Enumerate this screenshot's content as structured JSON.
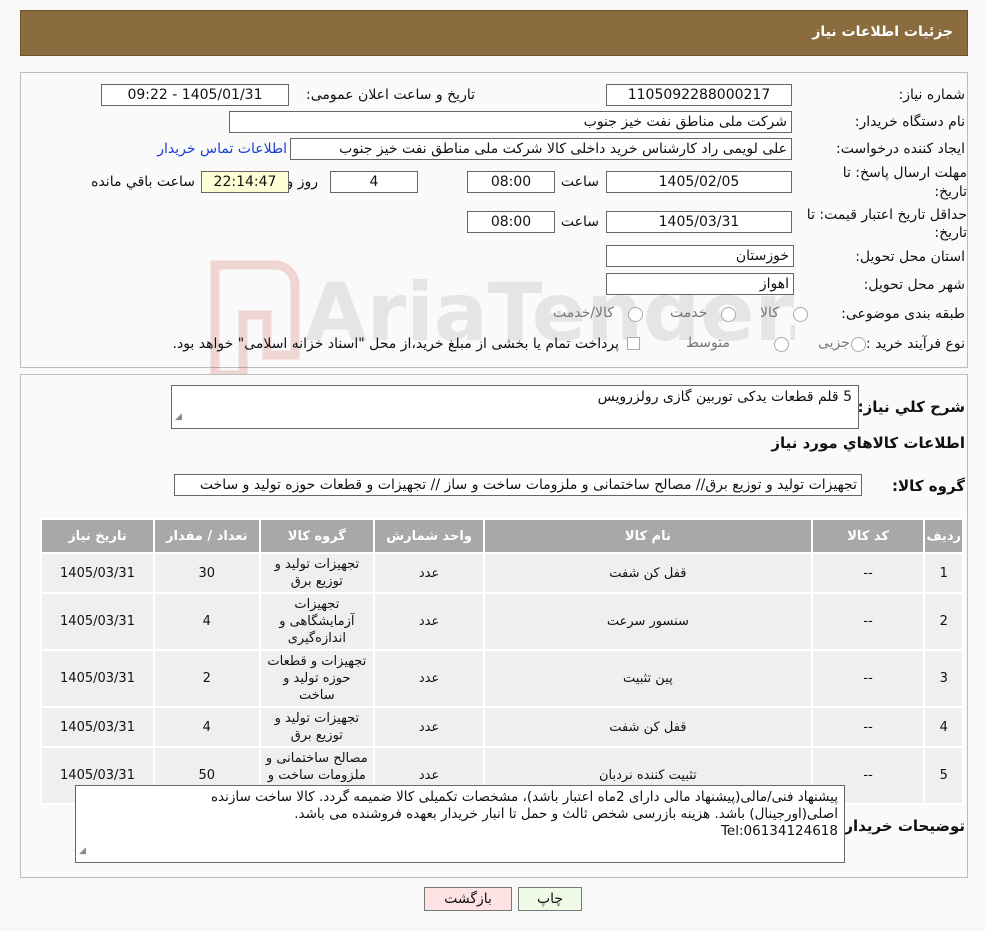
{
  "header": {
    "title": "جزئیات اطلاعات نیاز"
  },
  "form": {
    "need_number_label": "شماره نیاز:",
    "need_number": "1105092288000217",
    "announce_label": "تاریخ و ساعت اعلان عمومی:",
    "announce_value": "1405/01/31 - 09:22",
    "buyer_org_label": "نام دستگاه خریدار:",
    "buyer_org": "شرکت ملی مناطق نفت خیز جنوب",
    "creator_label": "ایجاد کننده درخواست:",
    "creator": "علی  لویمی راد  کارشناس خرید داخلی کالا شرکت ملی مناطق نفت خیز جنوب",
    "contact_link": "اطلاعات تماس خریدار",
    "reply_deadline_label_1": "مهلت ارسال پاسخ: تا",
    "reply_deadline_label_2": "تاریخ:",
    "reply_date": "1405/02/05",
    "time_label": "ساعت",
    "reply_time": "08:00",
    "days": "4",
    "days_label": "روز و",
    "remaining": "22:14:47",
    "remaining_label": "ساعت باقي مانده",
    "validity_label_1": "حداقل تاریخ اعتبار قیمت: تا",
    "validity_label_2": "تاریخ:",
    "validity_date": "1405/03/31",
    "validity_time": "08:00",
    "province_label": "استان محل تحویل:",
    "province": "خوزستان",
    "city_label": "شهر محل تحویل:",
    "city": "اهواز",
    "category_label": "طبقه بندی موضوعی:",
    "category_options": [
      "کالا",
      "خدمت",
      "کالا/خدمت"
    ],
    "process_label": "نوع فرآیند خرید :",
    "process_options": [
      "جزیی",
      "متوسط"
    ],
    "process_note": "پرداخت تمام یا بخشی از مبلغ خرید،از محل \"اسناد خزانه اسلامی\" خواهد بود."
  },
  "summary": {
    "desc_label": "شرح کلي نياز:",
    "desc": "5 قلم قطعات یدکی توربین گازی رولزرویس",
    "items_title": "اطلاعات کالاهاي مورد نياز",
    "group_label": "گروه کالا:",
    "group_value": "تجهیزات تولید و توزیع برق// مصالح ساختمانی و ملزومات ساخت و ساز // تجهیزات و قطعات حوزه تولید و ساخت"
  },
  "table": {
    "headers": [
      "ردیف",
      "کد کالا",
      "نام کالا",
      "واحد شمارش",
      "گروه کالا",
      "تعداد / مقدار",
      "تاریخ نیاز"
    ],
    "rows": [
      [
        "1",
        "--",
        "قفل کن شفت",
        "عدد",
        "تجهیزات تولید و توزیع برق",
        "30",
        "1405/03/31"
      ],
      [
        "2",
        "--",
        "سنسور سرعت",
        "عدد",
        "تجهیزات آزمایشگاهی و اندازه‌گیری",
        "4",
        "1405/03/31"
      ],
      [
        "3",
        "--",
        "پین تثبیت",
        "عدد",
        "تجهیزات و قطعات حوزه تولید و ساخت",
        "2",
        "1405/03/31"
      ],
      [
        "4",
        "--",
        "قفل کن شفت",
        "عدد",
        "تجهیزات تولید و توزیع برق",
        "4",
        "1405/03/31"
      ],
      [
        "5",
        "--",
        "تثبیت کننده نردبان",
        "عدد",
        "مصالح ساختمانی و ملزومات ساخت و ساز",
        "50",
        "1405/03/31"
      ]
    ]
  },
  "buyer_notes": {
    "label": "توضیحات خریدار:",
    "line1": "پیشنهاد فنی/مالی(پیشنهاد مالی دارای 2ماه اعتبار باشد)، مشخصات تکمیلی کالا ضمیمه گردد. کالا ساخت سازنده",
    "line2": "اصلی(اورجینال) باشد. هزینه بازرسی  شخص ثالث و حمل تا انبار خریدار بعهده فروشنده می باشد.",
    "line3": "Tel:06134124618"
  },
  "buttons": {
    "print": "چاپ",
    "back": "بازگشت"
  },
  "watermark": {
    "brand": "AriaTender.neT"
  },
  "colors": {
    "header_bg": "#8a6c3f",
    "table_header_bg": "#a8a8a8",
    "link": "#1a3fd3",
    "back_btn_bg": "#fde3e3",
    "print_btn_bg": "#eefae6"
  }
}
